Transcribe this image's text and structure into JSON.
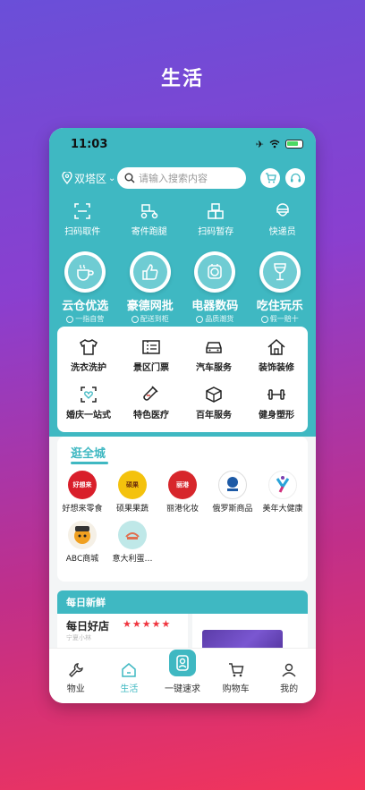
{
  "page_heading": "生活",
  "status": {
    "time": "11:03"
  },
  "topbar": {
    "location": "双塔区",
    "search_placeholder": "请输入搜索内容"
  },
  "quick_actions": [
    {
      "label": "扫码取件",
      "icon": "scan-icon"
    },
    {
      "label": "寄件跑腿",
      "icon": "delivery-scooter-icon"
    },
    {
      "label": "扫码暂存",
      "icon": "boxes-icon"
    },
    {
      "label": "快递员",
      "icon": "courier-icon"
    }
  ],
  "categories": [
    {
      "title": "云仓优选",
      "sub": "一指自营",
      "icon": "coffee-cup-icon"
    },
    {
      "title": "豪德网批",
      "sub": "配送到柜",
      "icon": "thumbs-up-icon"
    },
    {
      "title": "电器数码",
      "sub": "品质潮货",
      "icon": "appliance-icon"
    },
    {
      "title": "吃住玩乐",
      "sub": "假一赔十",
      "icon": "wine-glass-icon"
    }
  ],
  "services": [
    {
      "label": "洗衣洗护",
      "icon": "tshirt-icon"
    },
    {
      "label": "景区门票",
      "icon": "ticket-icon"
    },
    {
      "label": "汽车服务",
      "icon": "car-icon"
    },
    {
      "label": "装饰装修",
      "icon": "house-icon"
    },
    {
      "label": "婚庆一站式",
      "icon": "wedding-frame-icon"
    },
    {
      "label": "特色医疗",
      "icon": "test-tube-icon"
    },
    {
      "label": "百年服务",
      "icon": "box-icon"
    },
    {
      "label": "健身塑形",
      "icon": "dumbbell-icon"
    }
  ],
  "mall": {
    "title": "逛全城",
    "brands": [
      {
        "name": "好想来零食",
        "logo_text": "好想来",
        "color": "#d91e2a"
      },
      {
        "name": "硕果果蔬",
        "logo_text": "硕果",
        "color": "#f4c20d"
      },
      {
        "name": "丽港化妆",
        "logo_text": "丽港",
        "color": "#d7262b"
      },
      {
        "name": "俄罗斯商品",
        "logo_text": "",
        "color": "#1d5aa6"
      },
      {
        "name": "美年大健康",
        "logo_text": "",
        "color": "#ffffff"
      },
      {
        "name": "ABC商城",
        "logo_text": "",
        "color": "#f0a020"
      },
      {
        "name": "意大利蛋…",
        "logo_text": "",
        "color": "#7fcfcf"
      }
    ]
  },
  "daily": {
    "header": "每日新鲜",
    "good_store": "每日好店",
    "stars": "★★★★★",
    "sub": "宁夏小林"
  },
  "tabs": [
    {
      "label": "物业",
      "icon": "wrench-icon",
      "active": false
    },
    {
      "label": "生活",
      "icon": "home-icon",
      "active": true
    },
    {
      "label": "一键速求",
      "icon": "request-icon",
      "active": false
    },
    {
      "label": "购物车",
      "icon": "cart-icon",
      "active": false
    },
    {
      "label": "我的",
      "icon": "person-icon",
      "active": false
    }
  ]
}
